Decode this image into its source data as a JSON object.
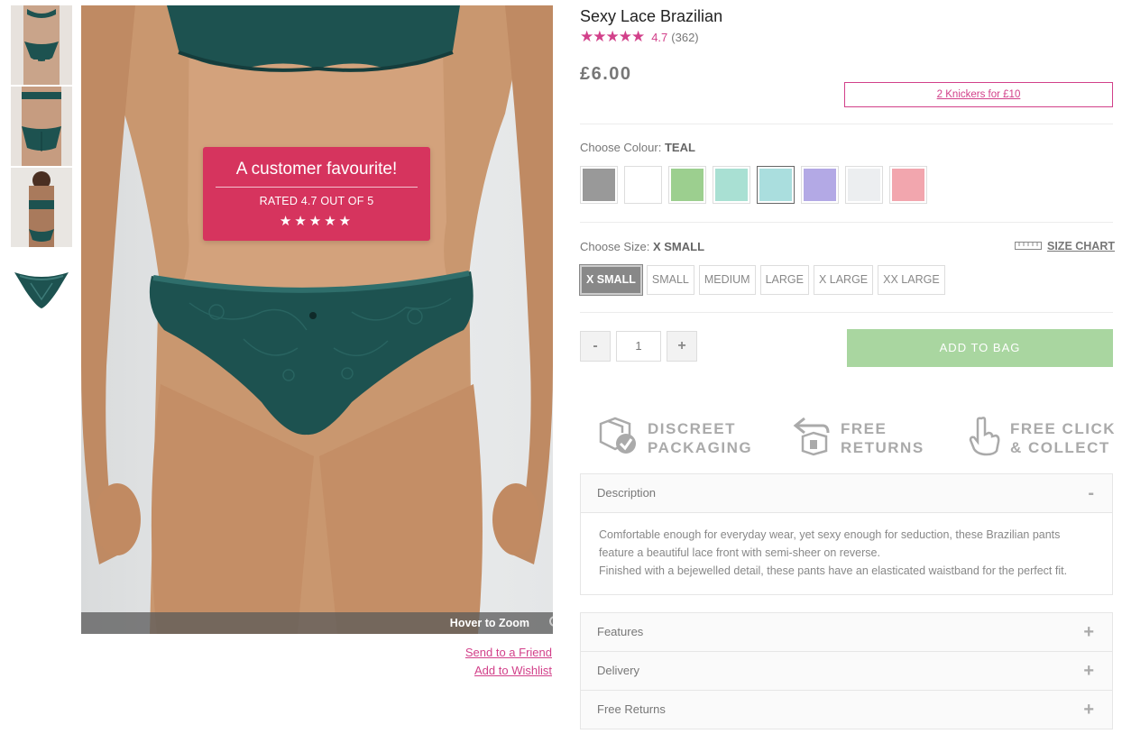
{
  "product": {
    "title": "Sexy Lace Brazilian",
    "rating_stars": "★★★★★",
    "rating_value": "4.7",
    "rating_count": "(362)",
    "price": "£6.00",
    "offer": "2 Knickers for £10"
  },
  "image": {
    "badge_title": "A customer favourite!",
    "badge_subtitle": "RATED 4.7 OUT OF 5",
    "badge_stars": "★★★★★",
    "zoom_hint": "Hover to Zoom"
  },
  "links": {
    "send_to_friend": "Send to a Friend",
    "add_to_wishlist": "Add to Wishlist"
  },
  "colour": {
    "label": "Choose Colour:",
    "selected": "TEAL",
    "swatches": [
      {
        "name": "grey",
        "color": "#999999"
      },
      {
        "name": "white",
        "color": "#ffffff"
      },
      {
        "name": "green",
        "color": "#9ccf8f"
      },
      {
        "name": "mint",
        "color": "#a9e0d3"
      },
      {
        "name": "teal",
        "color": "#aadede"
      },
      {
        "name": "lilac",
        "color": "#b3a9e5"
      },
      {
        "name": "light-grey",
        "color": "#eceef0"
      },
      {
        "name": "pink",
        "color": "#f2a6ae"
      }
    ]
  },
  "size": {
    "label": "Choose Size:",
    "selected": "X SMALL",
    "chart_label": "SIZE CHART",
    "options": [
      "X SMALL",
      "SMALL",
      "MEDIUM",
      "LARGE",
      "X LARGE",
      "XX LARGE"
    ]
  },
  "quantity": {
    "minus": "-",
    "value": "1",
    "plus": "+"
  },
  "add_to_bag": "ADD TO BAG",
  "features": [
    {
      "line1": "DISCREET",
      "line2": "PACKAGING"
    },
    {
      "line1": "FREE",
      "line2": "RETURNS"
    },
    {
      "line1": "FREE CLICK",
      "line2": "& COLLECT"
    }
  ],
  "accordion": {
    "description_title": "Description",
    "description_sign": "-",
    "description_p1": "Comfortable enough for everyday wear, yet sexy enough for seduction, these Brazilian pants feature a beautiful lace front with semi-sheer on reverse.",
    "description_p2": "Finished with a bejewelled detail, these pants have an elasticated waistband for the perfect fit.",
    "features_title": "Features",
    "delivery_title": "Delivery",
    "returns_title": "Free Returns",
    "plus_sign": "+"
  },
  "colors": {
    "accent_pink": "#d2408a",
    "badge_red": "#d6345e",
    "add_to_bag_green": "#a9d6a0",
    "garment_teal": "#1d5250"
  }
}
